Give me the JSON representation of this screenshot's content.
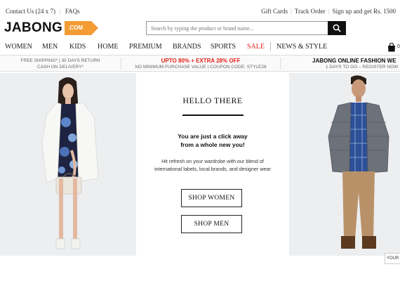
{
  "topbar": {
    "contact": "Contact Us (24 x 7)",
    "faqs": "FAQs",
    "gift_cards": "Gift Cards",
    "track_order": "Track Order",
    "signup": "Sign up and get Rs. 1500"
  },
  "logo": {
    "text": "JABONG",
    "tag": ".COM"
  },
  "search": {
    "placeholder": "Search by typing the product or brand name...",
    "icon": "search-icon"
  },
  "nav": {
    "items": [
      "WOMEN",
      "MEN",
      "KIDS",
      "HOME",
      "PREMIUM",
      "BRANDS",
      "SPORTS",
      "SALE",
      "NEWS & STYLE"
    ],
    "bag_icon": "shopping-bag-icon",
    "bag_count": "0"
  },
  "promo": {
    "shipping_line1": "FREE SHIPPING* | 30 DAYS RETURN",
    "shipping_line2": "CASH ON DELIVERY*",
    "offer_line1": "UPTO 80% + EXTRA 28% OFF",
    "offer_line2": "NO MINIMUM PURCHASE VALUE | COUPON CODE: STYLE28",
    "fest_line1": "JABONG ONLINE FASHION WE",
    "fest_line2": "1 DAYS TO GO – REGISTER NOW"
  },
  "hero": {
    "title": "HELLO THERE",
    "tagline_1": "You are just a click away",
    "tagline_2": "from a whole new you!",
    "desc_1": "Hit refresh on your wardrobe with our blend of",
    "desc_2": "international labels, local brands, and designer wear",
    "shop_women": "SHOP WOMEN",
    "shop_men": "SHOP MEN"
  },
  "side_tab": "YOUR",
  "colors": {
    "accent": "#f39c34",
    "sale": "#e2231a"
  }
}
